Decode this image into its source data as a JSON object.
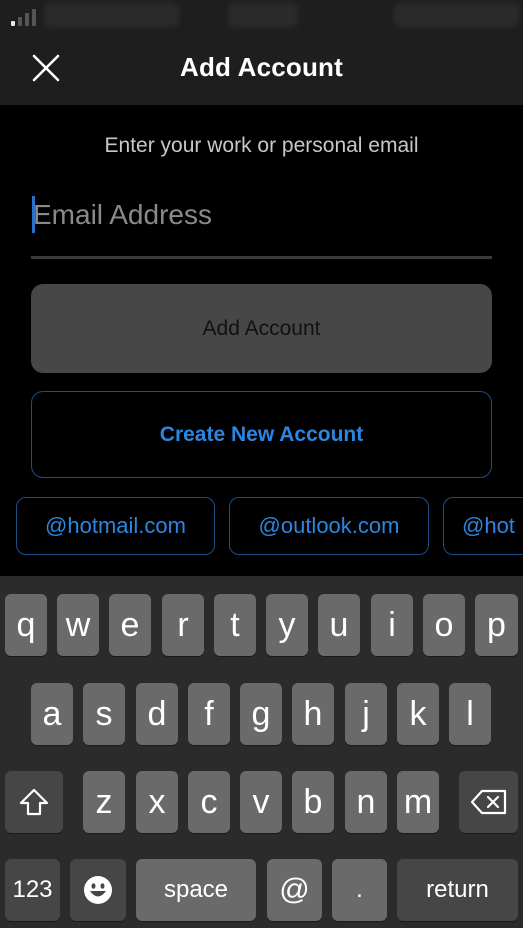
{
  "status_bar": {
    "signal_bars_active": 1,
    "signal_bars_total": 4
  },
  "navbar": {
    "title": "Add Account",
    "close_icon": "close-icon"
  },
  "form": {
    "instructions": "Enter your work or personal email",
    "email_value": "",
    "email_placeholder": "Email Address",
    "add_account_label": "Add Account",
    "create_account_label": "Create New Account"
  },
  "domain_chips": [
    {
      "label": "@hotmail.com"
    },
    {
      "label": "@outlook.com"
    },
    {
      "label": "@hot"
    }
  ],
  "keyboard": {
    "row1": [
      "q",
      "w",
      "e",
      "r",
      "t",
      "y",
      "u",
      "i",
      "o",
      "p"
    ],
    "row2": [
      "a",
      "s",
      "d",
      "f",
      "g",
      "h",
      "j",
      "k",
      "l"
    ],
    "row3": [
      "z",
      "x",
      "c",
      "v",
      "b",
      "n",
      "m"
    ],
    "shift_icon": "shift-icon",
    "delete_icon": "backspace-icon",
    "numbers_label": "123",
    "emoji_icon": "emoji-icon",
    "space_label": "space",
    "at_label": "@",
    "dot_label": ".",
    "return_label": "return"
  },
  "colors": {
    "accent": "#2c86e0",
    "accent_border": "#1d4f86",
    "disabled_button": "#474747",
    "key": "#6a6a6a",
    "special_key": "#464646",
    "keyboard_bg": "#2b2b2b"
  }
}
